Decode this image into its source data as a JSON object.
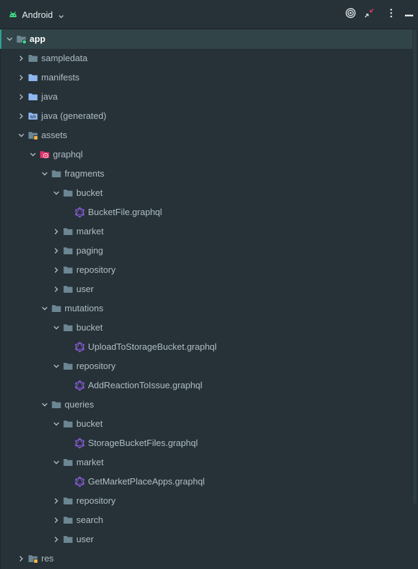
{
  "toolbar": {
    "view_title": "Android",
    "buttons": [
      "target-icon",
      "collapse-icon",
      "more-vert-icon",
      "minimize-icon"
    ]
  },
  "tree": [
    {
      "label": "app",
      "level": 0,
      "expanded": true,
      "icon": "module-folder",
      "selected": true,
      "bold": true
    },
    {
      "label": "sampledata",
      "level": 1,
      "expanded": false,
      "icon": "folder"
    },
    {
      "label": "manifests",
      "level": 1,
      "expanded": false,
      "icon": "folder-blue"
    },
    {
      "label": "java",
      "level": 1,
      "expanded": false,
      "icon": "folder-blue"
    },
    {
      "label": "java (generated)",
      "level": 1,
      "expanded": false,
      "icon": "folder-generated"
    },
    {
      "label": "assets",
      "level": 1,
      "expanded": true,
      "icon": "folder-resource"
    },
    {
      "label": "graphql",
      "level": 2,
      "expanded": true,
      "icon": "folder-graphql"
    },
    {
      "label": "fragments",
      "level": 3,
      "expanded": true,
      "icon": "folder"
    },
    {
      "label": "bucket",
      "level": 4,
      "expanded": true,
      "icon": "folder"
    },
    {
      "label": "BucketFile.graphql",
      "level": 5,
      "icon": "graphql-file"
    },
    {
      "label": "market",
      "level": 4,
      "expanded": false,
      "icon": "folder"
    },
    {
      "label": "paging",
      "level": 4,
      "expanded": false,
      "icon": "folder"
    },
    {
      "label": "repository",
      "level": 4,
      "expanded": false,
      "icon": "folder"
    },
    {
      "label": "user",
      "level": 4,
      "expanded": false,
      "icon": "folder"
    },
    {
      "label": "mutations",
      "level": 3,
      "expanded": true,
      "icon": "folder"
    },
    {
      "label": "bucket",
      "level": 4,
      "expanded": true,
      "icon": "folder"
    },
    {
      "label": "UploadToStorageBucket.graphql",
      "level": 5,
      "icon": "graphql-file"
    },
    {
      "label": "repository",
      "level": 4,
      "expanded": true,
      "icon": "folder"
    },
    {
      "label": "AddReactionToIssue.graphql",
      "level": 5,
      "icon": "graphql-file"
    },
    {
      "label": "queries",
      "level": 3,
      "expanded": true,
      "icon": "folder"
    },
    {
      "label": "bucket",
      "level": 4,
      "expanded": true,
      "icon": "folder"
    },
    {
      "label": "StorageBucketFiles.graphql",
      "level": 5,
      "icon": "graphql-file"
    },
    {
      "label": "market",
      "level": 4,
      "expanded": true,
      "icon": "folder"
    },
    {
      "label": "GetMarketPlaceApps.graphql",
      "level": 5,
      "icon": "graphql-file"
    },
    {
      "label": "repository",
      "level": 4,
      "expanded": false,
      "icon": "folder"
    },
    {
      "label": "search",
      "level": 4,
      "expanded": false,
      "icon": "folder"
    },
    {
      "label": "user",
      "level": 4,
      "expanded": false,
      "icon": "folder"
    },
    {
      "label": "res",
      "level": 1,
      "expanded": false,
      "icon": "folder-resource"
    }
  ],
  "colors": {
    "background": "#263238",
    "selection": "#314549",
    "accent": "#2ea39a",
    "folder": "#6c8693",
    "folder_blue": "#8fb6f0",
    "graphql": "#8a5ad6",
    "graphql_folder": "#e5356b",
    "android": "#3ddc84"
  }
}
